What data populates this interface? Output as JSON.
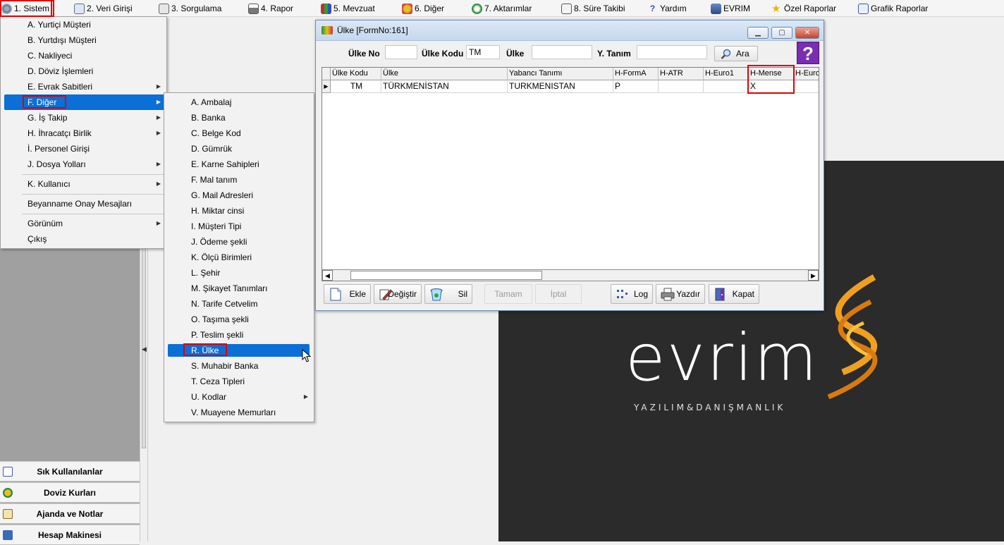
{
  "menubar": {
    "items": [
      {
        "label": "1.  Sistem",
        "icon": "gear-icon"
      },
      {
        "label": "2.  Veri Girişi",
        "icon": "edit-icon"
      },
      {
        "label": "3.  Sorgulama",
        "icon": "query-icon"
      },
      {
        "label": "4.  Rapor",
        "icon": "printer-icon"
      },
      {
        "label": "5.  Mevzuat",
        "icon": "books-icon"
      },
      {
        "label": "6.  Diğer",
        "icon": "puzzle-icon"
      },
      {
        "label": "7.  Aktarımlar",
        "icon": "transfer-icon"
      },
      {
        "label": "8. Süre Takibi",
        "icon": "clipboard-icon"
      },
      {
        "label": "Yardım",
        "icon": "help-icon"
      },
      {
        "label": "EVRIM",
        "icon": "evrim-icon"
      },
      {
        "label": "Özel Raporlar",
        "icon": "star-icon"
      },
      {
        "label": "Grafik Raporlar",
        "icon": "chart-icon"
      }
    ]
  },
  "sistem_menu": {
    "items": [
      {
        "label": "A.  Yurtiçi Müşteri",
        "submenu": false
      },
      {
        "label": "B.  Yurtdışı Müşteri",
        "submenu": false
      },
      {
        "label": "C.  Nakliyeci",
        "submenu": false
      },
      {
        "label": "D.  Döviz İşlemleri",
        "submenu": false
      },
      {
        "label": "E.  Evrak Sabitleri",
        "submenu": true
      },
      {
        "label": "F.  Diğer",
        "submenu": true
      },
      {
        "label": "G.  İş Takip",
        "submenu": true
      },
      {
        "label": "H.  İhracatçı Birlik",
        "submenu": true
      },
      {
        "label": "İ.   Personel Girişi",
        "submenu": false
      },
      {
        "label": "J.  Dosya Yolları",
        "submenu": true
      },
      {
        "label": "K.  Kullanıcı",
        "submenu": true
      },
      {
        "label": "Beyanname Onay Mesajları",
        "submenu": false
      },
      {
        "label": "Görünüm",
        "submenu": true
      },
      {
        "label": "Çıkış",
        "submenu": false
      }
    ]
  },
  "diger_menu": {
    "items": [
      {
        "label": "A.  Ambalaj",
        "submenu": false
      },
      {
        "label": "B.  Banka",
        "submenu": false
      },
      {
        "label": "C.  Belge Kod",
        "submenu": false
      },
      {
        "label": "D.  Gümrük",
        "submenu": false
      },
      {
        "label": "E.  Karne Sahipleri",
        "submenu": false
      },
      {
        "label": "F.  Mal tanım",
        "submenu": false
      },
      {
        "label": "G.  Mail Adresleri",
        "submenu": false
      },
      {
        "label": "H.  Miktar cinsi",
        "submenu": false
      },
      {
        "label": "I.  Müşteri Tipi",
        "submenu": false
      },
      {
        "label": "J.  Ödeme şekli",
        "submenu": false
      },
      {
        "label": "K.  Ölçü Birimleri",
        "submenu": false
      },
      {
        "label": "L.  Şehir",
        "submenu": false
      },
      {
        "label": "M.  Şikayet Tanımları",
        "submenu": false
      },
      {
        "label": "N.  Tarife Cetvelim",
        "submenu": false
      },
      {
        "label": "O.  Taşıma şekli",
        "submenu": false
      },
      {
        "label": "P.  Teslim şekli",
        "submenu": false
      },
      {
        "label": "R.  Ülke",
        "submenu": false
      },
      {
        "label": "S.  Muhabir Banka",
        "submenu": false
      },
      {
        "label": "T.  Ceza Tipleri",
        "submenu": false
      },
      {
        "label": "U. Kodlar",
        "submenu": true
      },
      {
        "label": "V. Muayene Memurları",
        "submenu": false
      }
    ]
  },
  "form": {
    "title": "Ülke [FormNo:161]",
    "labels": {
      "ulke_no": "Ülke No",
      "ulke_kodu": "Ülke Kodu",
      "ulke": "Ülke",
      "y_tanim": "Y. Tanım"
    },
    "values": {
      "ulke_no": "",
      "ulke_kodu": "TM",
      "ulke": "",
      "y_tanim": ""
    },
    "ara_label": "Ara",
    "help_label": "?",
    "grid": {
      "columns": [
        "Ülke Kodu",
        "Ülke",
        "Yabancı Tanımı",
        "H-FormA",
        "H-ATR",
        "H-Euro1",
        "H-Mense",
        "H-Euro"
      ],
      "rows": [
        [
          "TM",
          "TÜRKMENİSTAN",
          "TURKMENISTAN",
          "P",
          "",
          "",
          "X",
          ""
        ]
      ]
    },
    "buttons": {
      "ekle": "Ekle",
      "degistir": "Değiştir",
      "sil": "Sil",
      "tamam": "Tamam",
      "iptal": "İptal",
      "log": "Log",
      "yazdir": "Yazdır",
      "kapat": "Kapat"
    }
  },
  "shortcuts": [
    "Sık Kullanılanlar",
    "Doviz Kurları",
    "Ajanda ve Notlar",
    "Hesap Makinesi"
  ],
  "logo": {
    "text": "evrim",
    "subtitle": "YAZILIM&DANIŞMANLIK"
  },
  "colors": {
    "highlight": "#0a6fd6",
    "annotation": "#e00000",
    "logo_bg": "#2b2b2b",
    "logo_accent": "#f0a020"
  }
}
